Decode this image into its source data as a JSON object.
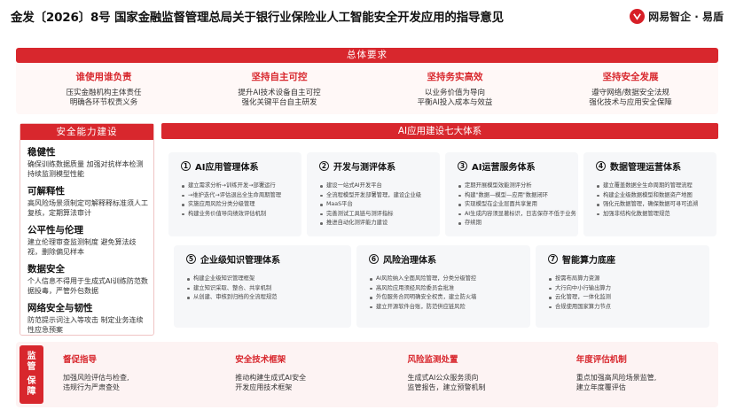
{
  "header": {
    "title": "金发〔2026〕8号  国家金融监督管理总局关于银行业保险业人工智能安全开发应用的指导意见",
    "brand": "网易智企 · 易盾"
  },
  "overall": {
    "banner": "总体要求",
    "items": [
      {
        "title": "谁使用谁负责",
        "lines": [
          "压实金融机构主体责任",
          "明确各环节权责义务"
        ]
      },
      {
        "title": "坚持自主可控",
        "lines": [
          "提升AI技术设备自主可控",
          "强化关键平台自主研发"
        ]
      },
      {
        "title": "坚持务实高效",
        "lines": [
          "以业务价值为导向",
          "平衡AI投入成本与效益"
        ]
      },
      {
        "title": "坚持安全发展",
        "lines": [
          "遵守网络/数据安全法规",
          "强化技术与应用安全保障"
        ]
      }
    ]
  },
  "security": {
    "title": "安全能力建设",
    "sections": [
      {
        "title": "稳健性",
        "text": "确保训练数据质量   加强对抗样本检测   持续监测模型性能"
      },
      {
        "title": "可解释性",
        "text": "高风险场景须制定可解释释标准须人工复核，定期算法审计"
      },
      {
        "title": "公平性与伦理",
        "text": "建立伦理审查监测制度   避免算法歧视，删除偏见样本"
      },
      {
        "title": "数据安全",
        "text": "个人信息不得用于生成式AI训练防范数据投毒，严管外包数据"
      },
      {
        "title": "网络安全与韧性",
        "text": "防范提示词注入等攻击   制定业务连续性应急预案"
      }
    ]
  },
  "ai_build": {
    "title": "AI应用建设七大体系",
    "systems": [
      {
        "num": "1",
        "title": "AI应用管理体系",
        "items": [
          "建立需求分析→训练开发→部署运行",
          "→维护迭代→评估退出全生命周期管理",
          "实施应用风险分类分级管理",
          "构建业务价值导向绩效评估机制"
        ]
      },
      {
        "num": "2",
        "title": "开发与测评体系",
        "items": [
          "建设一站式AI开发平台",
          "全流程模型开发部署管理，建设企业级",
          "MaaS平台",
          "完善测试工具链与测评指标",
          "推进自动化测评能力建设"
        ]
      },
      {
        "num": "3",
        "title": "AI运营服务体系",
        "items": [
          "定期开展模型效能测评分析",
          "构建\"数据—模型—应用\"数据闭环",
          "实现模型在企业层面共享复用",
          "AI生成内容须显著标识，日志保存不低于业务",
          "存续期"
        ]
      },
      {
        "num": "4",
        "title": "数据管理运营体系",
        "items": [
          "建立覆盖数据全生命周期的管理流程",
          "构建企业级数据模型和数据资产地图",
          "强化元数据管理，确保数据可寻可追溯",
          "加强非结构化数据管理规范"
        ]
      },
      {
        "num": "5",
        "title": "企业级知识管理体系",
        "items": [
          "构建企业级知识管理框架",
          "建立知识采取、整合、共享机制",
          "从创建、审核到归档的全流程规范"
        ]
      },
      {
        "num": "6",
        "title": "风险治理体系",
        "items": [
          "AI风险纳入全面风险管理，分类分级管控",
          "高风险应用须经风险委员会批准",
          "外包服务合同明确安全权责，建立防火墙",
          "建立开源软件台账，防范供应链风险"
        ]
      },
      {
        "num": "7",
        "title": "智能算力底座",
        "items": [
          "按需布局算力资源",
          "大行向中小行输出算力",
          "云化管理，一体化监测",
          "合规使用国家算力节点"
        ]
      }
    ]
  },
  "supervision": {
    "label": [
      "监",
      "管",
      "保",
      "障"
    ],
    "items": [
      {
        "title": "督促指导",
        "lines": [
          "加强风险评估与检查,",
          "违规行为严肃查处"
        ]
      },
      {
        "title": "安全技术框架",
        "lines": [
          "推动构建生成式AI安全",
          "开发应用技术框架"
        ]
      },
      {
        "title": "风险监测处置",
        "lines": [
          "生成式AI公众服务须向",
          "监管报告，建立预警机制"
        ]
      },
      {
        "title": "年度评估机制",
        "lines": [
          "重点加强高风险场景监管,",
          "建立年度覆评估"
        ]
      }
    ]
  },
  "colors": {
    "accent": "#d8272d",
    "panel_bg": "#f6f7f9",
    "light_red": "#fdf3f3"
  }
}
